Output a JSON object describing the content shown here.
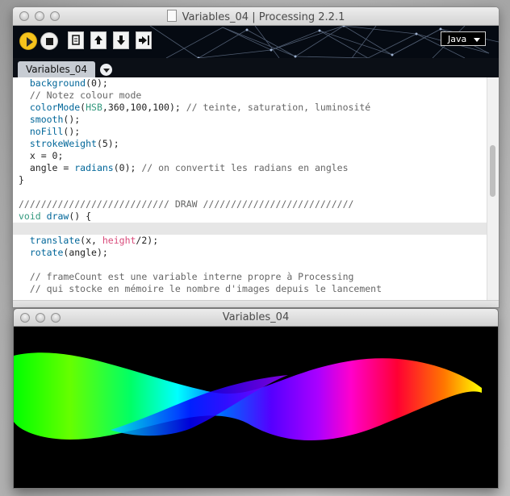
{
  "ide": {
    "title": "Variables_04 | Processing 2.2.1",
    "mode_label": "Java",
    "tab_label": "Variables_04",
    "toolbar": {
      "run_icon": "play-icon",
      "stop_icon": "stop-icon",
      "new_icon": "new-file-icon",
      "open_icon": "open-up-arrow-icon",
      "save_icon": "save-down-arrow-icon",
      "export_icon": "export-arrow-icon"
    }
  },
  "code": [
    {
      "parts": [
        [
          "",
          "  "
        ],
        [
          "fn",
          "background"
        ],
        [
          "",
          "(0);"
        ]
      ]
    },
    {
      "parts": [
        [
          "cm",
          "  // Notez colour mode"
        ]
      ]
    },
    {
      "parts": [
        [
          "",
          "  "
        ],
        [
          "fn",
          "colorMode"
        ],
        [
          "",
          "("
        ],
        [
          "kw",
          "HSB"
        ],
        [
          "",
          ",360,100,100); "
        ],
        [
          "cm",
          "// teinte, saturation, luminosité"
        ]
      ]
    },
    {
      "parts": [
        [
          "",
          "  "
        ],
        [
          "fn",
          "smooth"
        ],
        [
          "",
          "();"
        ]
      ]
    },
    {
      "parts": [
        [
          "",
          "  "
        ],
        [
          "fn",
          "noFill"
        ],
        [
          "",
          "();"
        ]
      ]
    },
    {
      "parts": [
        [
          "",
          "  "
        ],
        [
          "fn",
          "strokeWeight"
        ],
        [
          "",
          "(5);"
        ]
      ]
    },
    {
      "parts": [
        [
          "",
          "  x = 0;"
        ]
      ]
    },
    {
      "parts": [
        [
          "",
          "  angle = "
        ],
        [
          "fn",
          "radians"
        ],
        [
          "",
          "(0); "
        ],
        [
          "cm",
          "// on convertit les radians en angles"
        ]
      ]
    },
    {
      "parts": [
        [
          "",
          "}"
        ]
      ]
    },
    {
      "parts": [
        [
          "",
          ""
        ]
      ]
    },
    {
      "parts": [
        [
          "cm",
          "/////////////////////////// DRAW ///////////////////////////"
        ]
      ]
    },
    {
      "parts": [
        [
          "kw",
          "void"
        ],
        [
          "",
          " "
        ],
        [
          "fn",
          "draw"
        ],
        [
          "",
          "() {"
        ]
      ]
    },
    {
      "parts": [
        [
          "",
          ""
        ]
      ],
      "highlight": true
    },
    {
      "parts": [
        [
          "",
          "  "
        ],
        [
          "fn",
          "translate"
        ],
        [
          "",
          "(x, "
        ],
        [
          "vr",
          "height"
        ],
        [
          "",
          "/2);"
        ]
      ]
    },
    {
      "parts": [
        [
          "",
          "  "
        ],
        [
          "fn",
          "rotate"
        ],
        [
          "",
          "(angle);"
        ]
      ]
    },
    {
      "parts": [
        [
          "",
          ""
        ]
      ]
    },
    {
      "parts": [
        [
          "cm",
          "  // frameCount est une variable interne propre à Processing"
        ]
      ]
    },
    {
      "parts": [
        [
          "cm",
          "  // qui stocke en mémoire le nombre d'images depuis le lancement"
        ]
      ]
    }
  ],
  "sketch": {
    "title": "Variables_04"
  }
}
